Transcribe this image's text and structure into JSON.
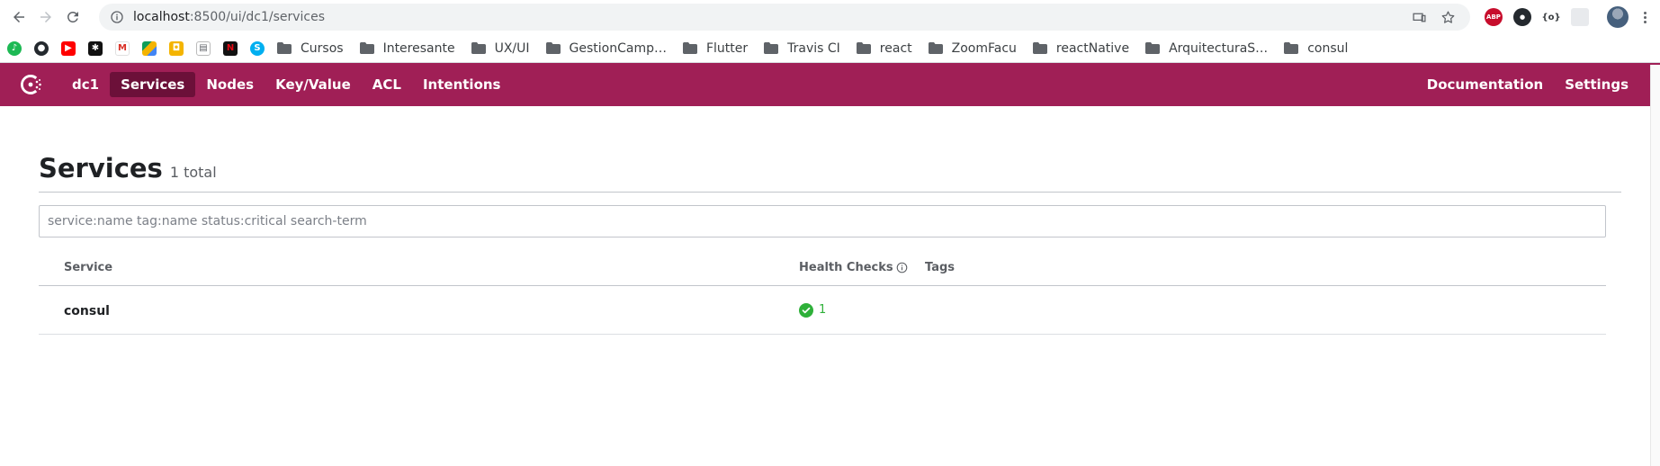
{
  "browser": {
    "url_host": "localhost",
    "url_path": ":8500/ui/dc1/services"
  },
  "bookmarks": {
    "folders": [
      "Cursos",
      "Interesante",
      "UX/UI",
      "GestionCamp…",
      "Flutter",
      "Travis CI",
      "react",
      "ZoomFacu",
      "reactNative",
      "ArquitecturaS…",
      "consul"
    ]
  },
  "header": {
    "datacenter": "dc1",
    "nav": [
      "Services",
      "Nodes",
      "Key/Value",
      "ACL",
      "Intentions"
    ],
    "right_nav": [
      "Documentation",
      "Settings"
    ]
  },
  "page": {
    "title": "Services",
    "total": "1 total",
    "search_placeholder": "service:name tag:name status:critical search-term"
  },
  "table": {
    "columns": [
      "Service",
      "Health Checks",
      "Tags"
    ],
    "rows": [
      {
        "service": "consul",
        "passing": "1",
        "tags": ""
      }
    ]
  },
  "colors": {
    "brand": "#a01f56",
    "brand_active": "#6c1039",
    "passing": "#2eb039"
  }
}
